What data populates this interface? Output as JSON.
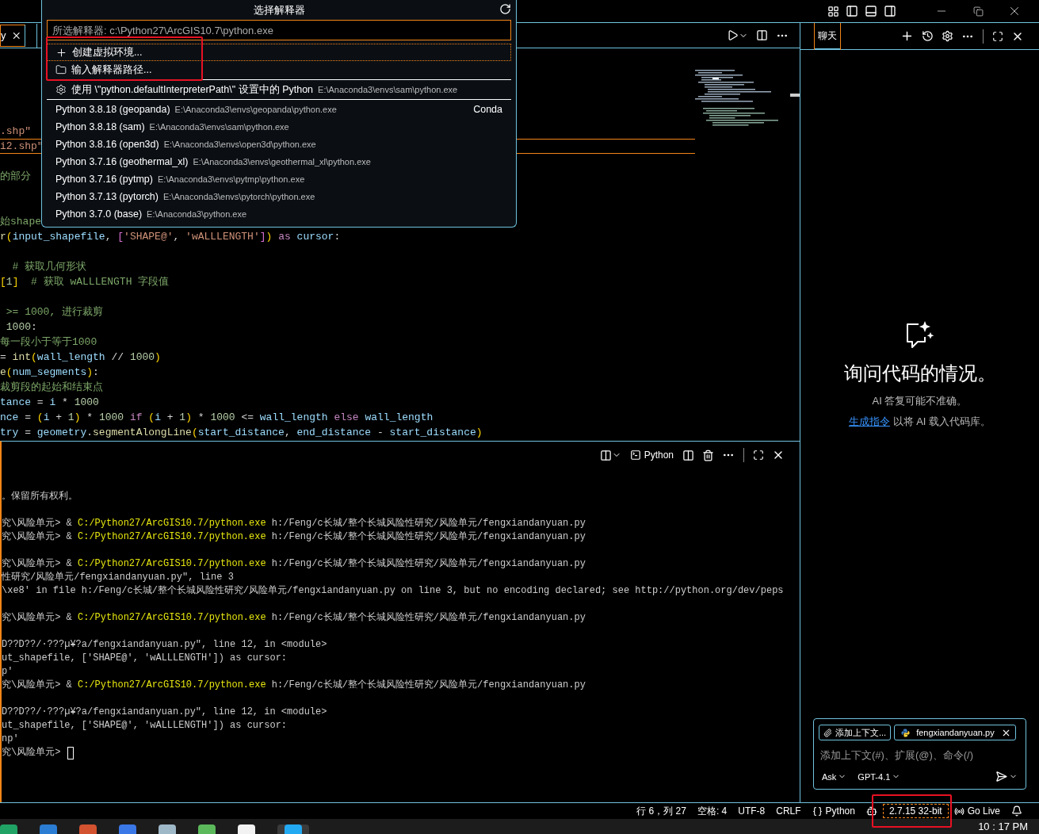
{
  "quick_pick": {
    "title": "选择解释器",
    "placeholder": "所选解释器: c:\\Python27\\ArcGIS10.7\\python.exe",
    "items": [
      {
        "kind": "create",
        "label": "创建虚拟环境...",
        "selected": true,
        "marked": true
      },
      {
        "kind": "path",
        "label": "输入解释器路径...",
        "selected": false,
        "marked": true
      },
      {
        "kind": "setting",
        "label": "使用 \\\"python.defaultInterpreterPath\\\" 设置中的 Python",
        "description": "E:\\Anaconda3\\envs\\sam\\python.exe",
        "selected": false,
        "marked": false
      },
      {
        "kind": "interpreter",
        "label": "Python 3.8.18 (geopanda)",
        "description": "E:\\Anaconda3\\envs\\geopanda\\python.exe",
        "detail": "Conda",
        "selected": false,
        "marked": false
      },
      {
        "kind": "interpreter",
        "label": "Python 3.8.18 (sam)",
        "description": "E:\\Anaconda3\\envs\\sam\\python.exe",
        "selected": false,
        "marked": false
      },
      {
        "kind": "interpreter",
        "label": "Python 3.8.16 (open3d)",
        "description": "E:\\Anaconda3\\envs\\open3d\\python.exe",
        "selected": false,
        "marked": false
      },
      {
        "kind": "interpreter",
        "label": "Python 3.7.16 (geothermal_xl)",
        "description": "E:\\Anaconda3\\envs\\geothermal_xl\\python.exe",
        "selected": false,
        "marked": false
      },
      {
        "kind": "interpreter",
        "label": "Python 3.7.16 (pytmp)",
        "description": "E:\\Anaconda3\\envs\\pytmp\\python.exe",
        "selected": false,
        "marked": false
      },
      {
        "kind": "interpreter",
        "label": "Python 3.7.13 (pytorch)",
        "description": "E:\\Anaconda3\\envs\\pytorch\\python.exe",
        "selected": false,
        "marked": false
      },
      {
        "kind": "interpreter",
        "label": "Python 3.7.0 (base)",
        "description": "E:\\Anaconda3\\python.exe",
        "selected": false,
        "marked": false
      }
    ]
  },
  "editor": {
    "tabs": [
      {
        "label": "y",
        "selected": true
      }
    ],
    "lines": [
      {
        "kind": "code",
        "current": false,
        "tokens": [
          {
            "kind": "str",
            "text": ".shp\""
          }
        ]
      },
      {
        "kind": "code",
        "current": true,
        "tokens": [
          {
            "kind": "str",
            "text": "i2.shp\""
          }
        ]
      },
      {
        "kind": "blank"
      },
      {
        "kind": "code",
        "current": false,
        "tokens": [
          {
            "kind": "com",
            "text": "的部分"
          }
        ]
      },
      {
        "kind": "blank"
      },
      {
        "kind": "blank"
      },
      {
        "kind": "code",
        "current": false,
        "tokens": [
          {
            "kind": "com",
            "text": "始shape"
          }
        ]
      },
      {
        "kind": "code",
        "current": false,
        "tokens": [
          {
            "kind": "fn",
            "text": "r"
          },
          {
            "kind": "br",
            "text": "("
          },
          {
            "kind": "var",
            "text": "input_shapefile"
          },
          {
            "kind": "plain",
            "text": ", "
          },
          {
            "kind": "pink",
            "text": "["
          },
          {
            "kind": "str",
            "text": "'SHAPE@'"
          },
          {
            "kind": "plain",
            "text": ", "
          },
          {
            "kind": "str",
            "text": "'wALLLENGTH'"
          },
          {
            "kind": "pink",
            "text": "]"
          },
          {
            "kind": "br",
            "text": ")"
          },
          {
            "kind": "kw",
            "text": " as "
          },
          {
            "kind": "var",
            "text": "cursor"
          },
          {
            "kind": "plain",
            "text": ":"
          }
        ]
      },
      {
        "kind": "blank"
      },
      {
        "kind": "code",
        "current": false,
        "tokens": [
          {
            "kind": "com",
            "text": "  # 获取几何形状"
          }
        ]
      },
      {
        "kind": "code",
        "current": false,
        "tokens": [
          {
            "kind": "br",
            "text": "["
          },
          {
            "kind": "num",
            "text": "1"
          },
          {
            "kind": "br",
            "text": "]"
          },
          {
            "kind": "com",
            "text": "  # 获取 wALLLENGTH 字段值"
          }
        ]
      },
      {
        "kind": "blank"
      },
      {
        "kind": "code",
        "current": false,
        "tokens": [
          {
            "kind": "com",
            "text": " >= 1000, 进行裁剪"
          }
        ]
      },
      {
        "kind": "code",
        "current": false,
        "tokens": [
          {
            "kind": "num",
            "text": " 1000"
          },
          {
            "kind": "plain",
            "text": ":"
          }
        ]
      },
      {
        "kind": "code",
        "current": false,
        "tokens": [
          {
            "kind": "com",
            "text": "每一段小于等于1000"
          }
        ]
      },
      {
        "kind": "code",
        "current": false,
        "tokens": [
          {
            "kind": "plain",
            "text": "= "
          },
          {
            "kind": "fn",
            "text": "int"
          },
          {
            "kind": "br",
            "text": "("
          },
          {
            "kind": "var",
            "text": "wall_length"
          },
          {
            "kind": "plain",
            "text": " // "
          },
          {
            "kind": "num",
            "text": "1000"
          },
          {
            "kind": "br",
            "text": ")"
          }
        ]
      },
      {
        "kind": "code",
        "current": false,
        "tokens": [
          {
            "kind": "fn",
            "text": "e"
          },
          {
            "kind": "br",
            "text": "("
          },
          {
            "kind": "var",
            "text": "num_segments"
          },
          {
            "kind": "br",
            "text": ")"
          },
          {
            "kind": "plain",
            "text": ":"
          }
        ]
      },
      {
        "kind": "code",
        "current": false,
        "tokens": [
          {
            "kind": "com",
            "text": "裁剪段的起始和结束点"
          }
        ]
      },
      {
        "kind": "code",
        "current": false,
        "tokens": [
          {
            "kind": "var",
            "text": "tance"
          },
          {
            "kind": "plain",
            "text": " = "
          },
          {
            "kind": "var",
            "text": "i"
          },
          {
            "kind": "plain",
            "text": " * "
          },
          {
            "kind": "num",
            "text": "1000"
          }
        ]
      },
      {
        "kind": "code",
        "current": false,
        "tokens": [
          {
            "kind": "var",
            "text": "nce"
          },
          {
            "kind": "plain",
            "text": " = "
          },
          {
            "kind": "br",
            "text": "("
          },
          {
            "kind": "var",
            "text": "i"
          },
          {
            "kind": "plain",
            "text": " + "
          },
          {
            "kind": "num",
            "text": "1"
          },
          {
            "kind": "br",
            "text": ")"
          },
          {
            "kind": "plain",
            "text": " * "
          },
          {
            "kind": "num",
            "text": "1000"
          },
          {
            "kind": "kw",
            "text": " if "
          },
          {
            "kind": "br",
            "text": "("
          },
          {
            "kind": "var",
            "text": "i"
          },
          {
            "kind": "plain",
            "text": " + "
          },
          {
            "kind": "num",
            "text": "1"
          },
          {
            "kind": "br",
            "text": ")"
          },
          {
            "kind": "plain",
            "text": " * "
          },
          {
            "kind": "num",
            "text": "1000"
          },
          {
            "kind": "plain",
            "text": " <= "
          },
          {
            "kind": "var",
            "text": "wall_length"
          },
          {
            "kind": "kw",
            "text": " else "
          },
          {
            "kind": "var",
            "text": "wall_length"
          }
        ]
      },
      {
        "kind": "code",
        "current": false,
        "tokens": [
          {
            "kind": "var",
            "text": "try"
          },
          {
            "kind": "plain",
            "text": " = "
          },
          {
            "kind": "var",
            "text": "geometry"
          },
          {
            "kind": "plain",
            "text": "."
          },
          {
            "kind": "fn",
            "text": "segmentAlongLine"
          },
          {
            "kind": "br",
            "text": "("
          },
          {
            "kind": "var",
            "text": "start_distance"
          },
          {
            "kind": "plain",
            "text": ", "
          },
          {
            "kind": "var",
            "text": "end_distance"
          },
          {
            "kind": "plain",
            "text": " - "
          },
          {
            "kind": "var",
            "text": "start_distance"
          },
          {
            "kind": "br",
            "text": ")"
          }
        ]
      }
    ]
  },
  "terminal": {
    "shell": "Python",
    "lines": [
      {
        "kind": "text",
        "parts": [
          {
            "kind": "plain",
            "text": "。保留所有权利。"
          }
        ]
      },
      {
        "kind": "blank"
      },
      {
        "kind": "text",
        "parts": [
          {
            "kind": "plain",
            "text": "究\\风险单元> & "
          },
          {
            "kind": "exe",
            "text": "C:/Python27/ArcGIS10.7/python.exe"
          },
          {
            "kind": "plain",
            "text": " h:/Feng/c长城/整个长城风险性研究/风险单元/fengxiandanyuan.py"
          }
        ]
      },
      {
        "kind": "text",
        "parts": [
          {
            "kind": "plain",
            "text": "究\\风险单元> & "
          },
          {
            "kind": "exe",
            "text": "C:/Python27/ArcGIS10.7/python.exe"
          },
          {
            "kind": "plain",
            "text": " h:/Feng/c长城/整个长城风险性研究/风险单元/fengxiandanyuan.py"
          }
        ]
      },
      {
        "kind": "blank"
      },
      {
        "kind": "text",
        "parts": [
          {
            "kind": "plain",
            "text": "究\\风险单元> & "
          },
          {
            "kind": "exe",
            "text": "C:/Python27/ArcGIS10.7/python.exe"
          },
          {
            "kind": "plain",
            "text": " h:/Feng/c长城/整个长城风险性研究/风险单元/fengxiandanyuan.py"
          }
        ]
      },
      {
        "kind": "text",
        "parts": [
          {
            "kind": "plain",
            "text": "性研究/风险单元/fengxiandanyuan.py\", line 3"
          }
        ]
      },
      {
        "kind": "text",
        "parts": [
          {
            "kind": "plain",
            "text": "\\xe8' in file h:/Feng/c长城/整个长城风险性研究/风险单元/fengxiandanyuan.py on line 3, but no encoding declared; see http://python.org/dev/peps"
          }
        ]
      },
      {
        "kind": "blank"
      },
      {
        "kind": "text",
        "parts": [
          {
            "kind": "plain",
            "text": "究\\风险单元> & "
          },
          {
            "kind": "exe",
            "text": "C:/Python27/ArcGIS10.7/python.exe"
          },
          {
            "kind": "plain",
            "text": " h:/Feng/c长城/整个长城风险性研究/风险单元/fengxiandanyuan.py"
          }
        ]
      },
      {
        "kind": "blank"
      },
      {
        "kind": "text",
        "parts": [
          {
            "kind": "plain",
            "text": "D??D??/·???µ¥?a/fengxiandanyuan.py\", line 12, in <module>"
          }
        ]
      },
      {
        "kind": "text",
        "parts": [
          {
            "kind": "plain",
            "text": "ut_shapefile, ['SHAPE@', 'wALLLENGTH']) as cursor:"
          }
        ]
      },
      {
        "kind": "text",
        "parts": [
          {
            "kind": "plain",
            "text": "p'"
          }
        ]
      },
      {
        "kind": "text",
        "parts": [
          {
            "kind": "plain",
            "text": "究\\风险单元> & "
          },
          {
            "kind": "exe",
            "text": "C:/Python27/ArcGIS10.7/python.exe"
          },
          {
            "kind": "plain",
            "text": " h:/Feng/c长城/整个长城风险性研究/风险单元/fengxiandanyuan.py"
          }
        ]
      },
      {
        "kind": "blank"
      },
      {
        "kind": "text",
        "parts": [
          {
            "kind": "plain",
            "text": "D??D??/·???µ¥?a/fengxiandanyuan.py\", line 12, in <module>"
          }
        ]
      },
      {
        "kind": "text",
        "parts": [
          {
            "kind": "plain",
            "text": "ut_shapefile, ['SHAPE@', 'wALLLENGTH']) as cursor:"
          }
        ]
      },
      {
        "kind": "text",
        "parts": [
          {
            "kind": "plain",
            "text": "np'"
          }
        ]
      },
      {
        "kind": "prompt",
        "parts": [
          {
            "kind": "plain",
            "text": "究\\风险单元> "
          }
        ]
      }
    ]
  },
  "chat": {
    "tabs": [
      {
        "label": "聊天",
        "selected": true
      }
    ],
    "title": "询问代码的情况。",
    "note": "AI 答复可能不准确。",
    "link": "生成指令",
    "hint": " 以将 AI 载入代码库。",
    "chips": [
      {
        "kind": "add",
        "label": "添加上下文..."
      },
      {
        "kind": "file",
        "label": "fengxiandanyuan.py"
      }
    ],
    "placeholder": "添加上下文(#)、扩展(@)、命令(/)",
    "mode": "Ask",
    "model": "GPT-4.1"
  },
  "status_bar": [
    {
      "kind": "text",
      "label": "行 6，列 27",
      "marked": false
    },
    {
      "kind": "text",
      "label": "空格: 4",
      "marked": false
    },
    {
      "kind": "text",
      "label": "UTF-8",
      "marked": false
    },
    {
      "kind": "text",
      "label": "CRLF",
      "marked": false
    },
    {
      "kind": "language",
      "label": "Python",
      "marked": false
    },
    {
      "kind": "copilot",
      "marked": false
    },
    {
      "kind": "interpreter",
      "label": "2.7.15 32-bit",
      "marked": true
    },
    {
      "kind": "live",
      "label": "Go Live",
      "marked": false
    },
    {
      "kind": "bell",
      "marked": false
    }
  ],
  "taskbar": {
    "apps": [
      {
        "color": "#21a366",
        "selected": false
      },
      {
        "color": "#2b7cd3",
        "selected": false
      },
      {
        "color": "#d35230",
        "selected": false
      },
      {
        "color": "#3b78e7",
        "selected": false
      },
      {
        "color": "#9fb8c8",
        "selected": false
      },
      {
        "color": "#5bb85b",
        "selected": false
      },
      {
        "color": "#f2f2f2",
        "selected": false
      },
      {
        "color": "#23a9f2",
        "selected": true
      }
    ],
    "time": "10 : 17 PM"
  }
}
